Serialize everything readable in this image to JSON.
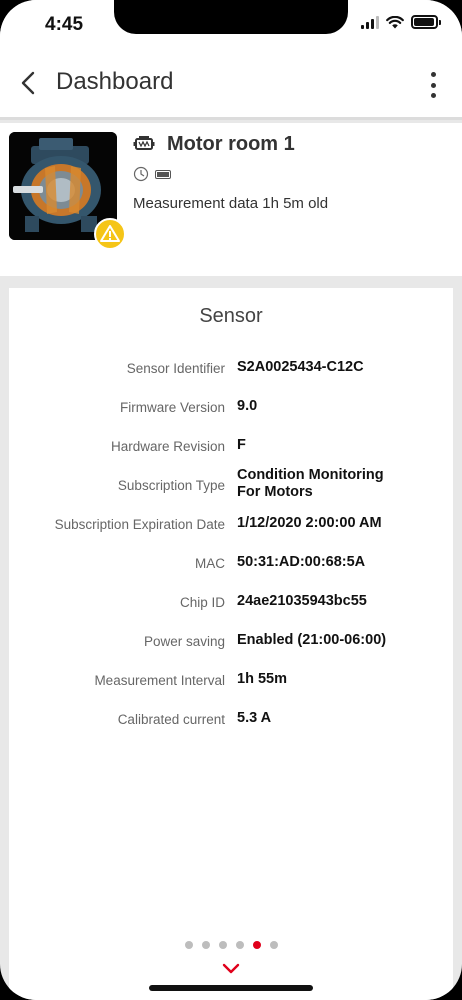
{
  "status_bar": {
    "time": "4:45"
  },
  "header": {
    "title": "Dashboard"
  },
  "asset": {
    "name": "Motor room 1",
    "measurement_age": "Measurement data 1h 5m old"
  },
  "sensor": {
    "title": "Sensor",
    "rows": [
      {
        "label": "Sensor Identifier",
        "value": "S2A0025434-C12C"
      },
      {
        "label": "Firmware Version",
        "value": "9.0"
      },
      {
        "label": "Hardware Revision",
        "value": "F"
      },
      {
        "label": "Subscription Type",
        "value": "Condition Monitoring For Motors"
      },
      {
        "label": "Subscription Expiration Date",
        "value": "1/12/2020 2:00:00 AM"
      },
      {
        "label": "MAC",
        "value": "50:31:AD:00:68:5A"
      },
      {
        "label": "Chip ID",
        "value": "24ae21035943bc55"
      },
      {
        "label": "Power saving",
        "value": "Enabled (21:00-06:00)"
      },
      {
        "label": "Measurement Interval",
        "value": "1h 55m"
      },
      {
        "label": "Calibrated current",
        "value": "5.3 A"
      }
    ]
  },
  "pager": {
    "count": 6,
    "active_index": 4
  },
  "colors": {
    "accent": "#e0001b",
    "warning": "#f5c518"
  }
}
